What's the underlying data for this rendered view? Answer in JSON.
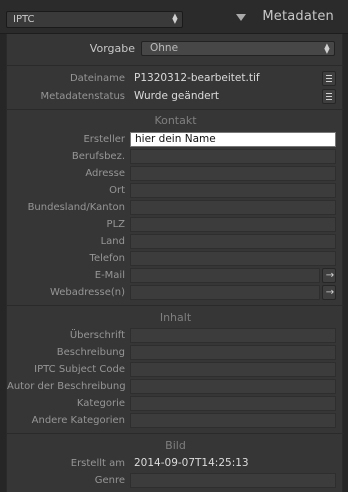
{
  "header": {
    "preset": "IPTC",
    "title": "Metadaten"
  },
  "vorgabe": {
    "label": "Vorgabe",
    "value": "Ohne"
  },
  "file": {
    "dateiname_label": "Dateiname",
    "dateiname_value": "P1320312-bearbeitet.tif",
    "status_label": "Metadatenstatus",
    "status_value": "Wurde geändert"
  },
  "kontakt": {
    "title": "Kontakt",
    "fields": [
      {
        "label": "Ersteller",
        "value": "hier dein Name"
      },
      {
        "label": "Berufsbez.",
        "value": ""
      },
      {
        "label": "Adresse",
        "value": ""
      },
      {
        "label": "Ort",
        "value": ""
      },
      {
        "label": "Bundesland/Kanton",
        "value": ""
      },
      {
        "label": "PLZ",
        "value": ""
      },
      {
        "label": "Land",
        "value": ""
      },
      {
        "label": "Telefon",
        "value": ""
      },
      {
        "label": "E-Mail",
        "value": ""
      },
      {
        "label": "Webadresse(n)",
        "value": ""
      }
    ]
  },
  "inhalt": {
    "title": "Inhalt",
    "fields": [
      {
        "label": "Überschrift",
        "value": ""
      },
      {
        "label": "Beschreibung",
        "value": ""
      },
      {
        "label": "IPTC Subject Code",
        "value": ""
      },
      {
        "label": "Autor der Beschreibung",
        "value": ""
      },
      {
        "label": "Kategorie",
        "value": ""
      },
      {
        "label": "Andere Kategorien",
        "value": ""
      }
    ]
  },
  "bild": {
    "title": "Bild",
    "fields": [
      {
        "label": "Erstellt am",
        "value": "2014-09-07T14:25:13"
      },
      {
        "label": "Genre",
        "value": ""
      }
    ]
  },
  "icons": {
    "list": "list-icon",
    "arrow": "→"
  }
}
